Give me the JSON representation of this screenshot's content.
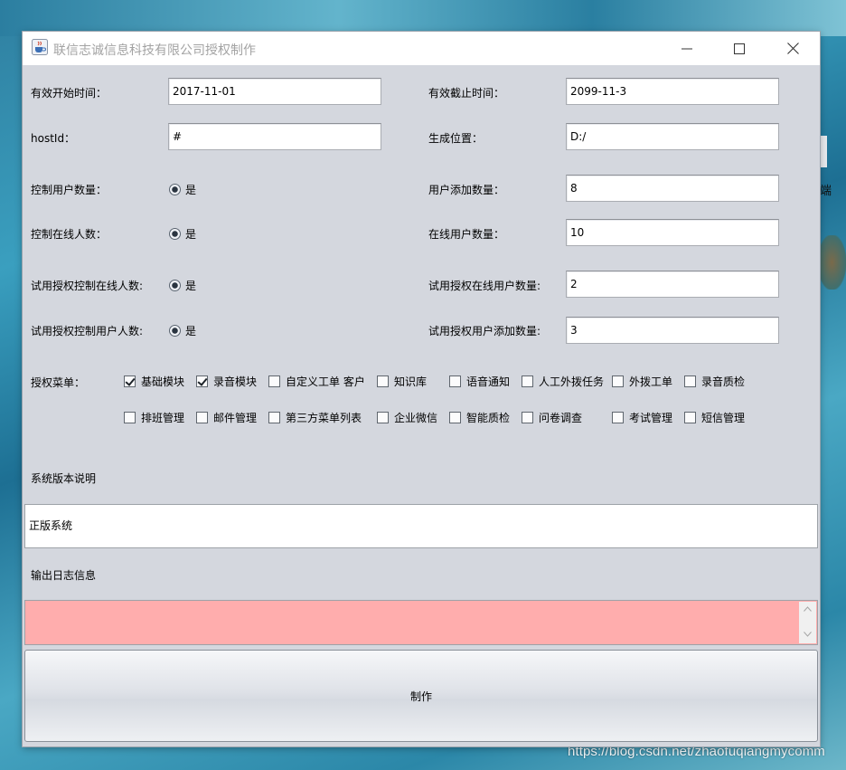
{
  "window": {
    "title": "联信志诚信息科技有限公司授权制作"
  },
  "form": {
    "start_time_label": "有效开始时间：",
    "start_time_value": "2017-11-01",
    "end_time_label": "有效截止时间：",
    "end_time_value": "2099-11-3",
    "hostid_label": "hostId：",
    "hostid_value": "#",
    "output_location_label": "生成位置：",
    "output_location_value": "D:/",
    "control_users_label": "控制用户数量：",
    "control_users_option": "是",
    "user_add_count_label": "用户添加数量：",
    "user_add_count_value": "8",
    "control_online_label": "控制在线人数：",
    "control_online_option": "是",
    "online_users_label": "在线用户数量：",
    "online_users_value": "10",
    "trial_control_online_label": "试用授权控制在线人数:",
    "trial_control_online_option": "是",
    "trial_online_users_label": "试用授权在线用户数量:",
    "trial_online_users_value": "2",
    "trial_control_users_label": "试用授权控制用户人数:",
    "trial_control_users_option": "是",
    "trial_user_add_label": "试用授权用户添加数量:",
    "trial_user_add_value": "3"
  },
  "menu": {
    "label": "授权菜单：",
    "items": [
      {
        "label": "基础模块",
        "checked": true
      },
      {
        "label": "录音模块",
        "checked": true
      },
      {
        "label": "自定义工单 客户",
        "checked": false
      },
      {
        "label": "知识库",
        "checked": false
      },
      {
        "label": "语音通知",
        "checked": false
      },
      {
        "label": "人工外拨任务",
        "checked": false
      },
      {
        "label": "外拨工单",
        "checked": false
      },
      {
        "label": "录音质检",
        "checked": false
      },
      {
        "label": "排班管理",
        "checked": false
      },
      {
        "label": "邮件管理",
        "checked": false
      },
      {
        "label": "第三方菜单列表",
        "checked": false
      },
      {
        "label": "企业微信",
        "checked": false
      },
      {
        "label": "智能质检",
        "checked": false
      },
      {
        "label": "问卷调查",
        "checked": false
      },
      {
        "label": "考试管理",
        "checked": false
      },
      {
        "label": "短信管理",
        "checked": false
      }
    ]
  },
  "version": {
    "label": "系统版本说明",
    "value": "正版系统"
  },
  "log": {
    "label": "输出日志信息",
    "value": "",
    "background": "#ffadad"
  },
  "actions": {
    "make_label": "制作"
  },
  "desktop": {
    "edge_glyph": "端",
    "watermark": "https://blog.csdn.net/zhaofuqiangmycomm"
  }
}
